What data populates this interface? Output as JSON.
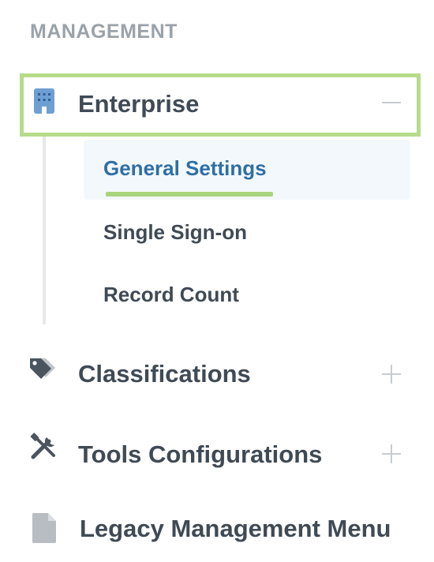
{
  "section": {
    "title": "MANAGEMENT"
  },
  "nav": {
    "enterprise": {
      "label": "Enterprise",
      "icon": "building-icon",
      "expanded": true
    },
    "enterprise_children": [
      {
        "label": "General Settings",
        "active": true
      },
      {
        "label": "Single Sign-on",
        "active": false
      },
      {
        "label": "Record Count",
        "active": false
      }
    ],
    "classifications": {
      "label": "Classifications",
      "icon": "tag-icon",
      "expanded": false
    },
    "tools": {
      "label": "Tools Configurations",
      "icon": "tools-icon",
      "expanded": false
    },
    "legacy": {
      "label": "Legacy Management Menu",
      "icon": "document-icon"
    }
  },
  "colors": {
    "highlight_border": "#b6dc8b",
    "active_text": "#2f6fa3",
    "active_underline": "#a9d47e",
    "active_bg": "#f3f8fd",
    "icon_blue": "#6e9fd3",
    "icon_gray": "#4a5560"
  }
}
